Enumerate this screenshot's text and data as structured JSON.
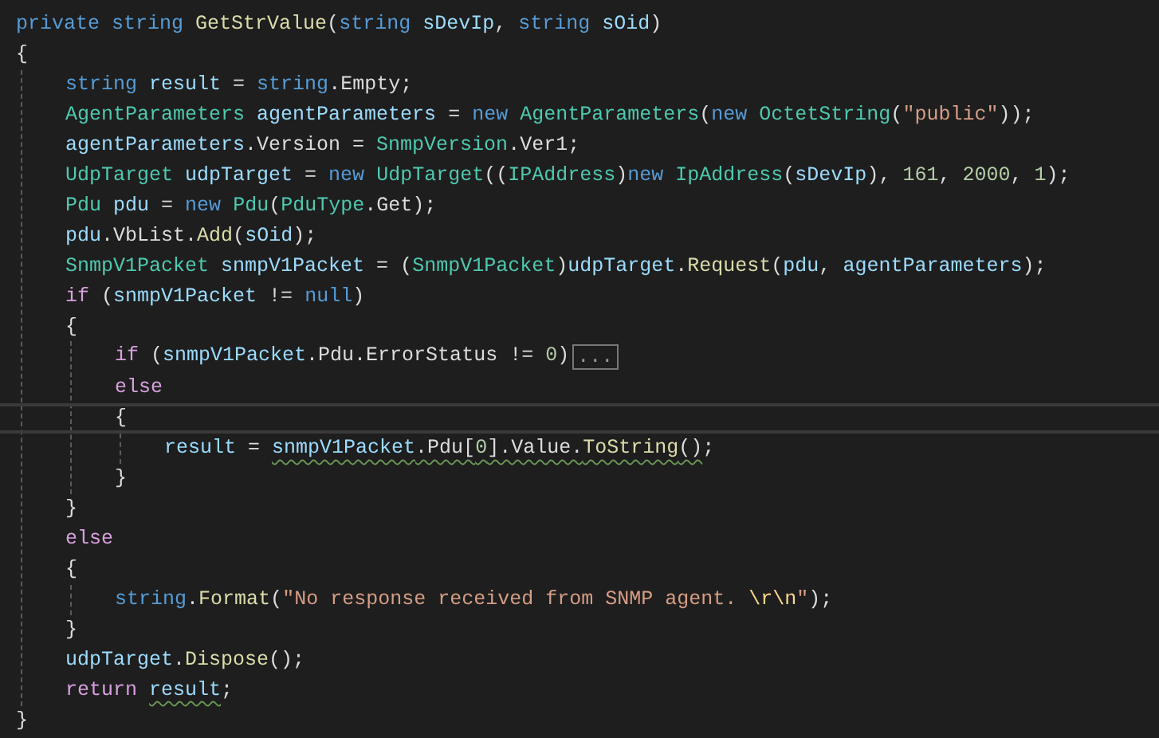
{
  "code_lines": [
    {
      "tokens": [
        {
          "text": "private ",
          "kind": "keyword"
        },
        {
          "text": "string ",
          "kind": "keyword"
        },
        {
          "text": "GetStrValue",
          "kind": "method"
        },
        {
          "text": "(",
          "kind": "plain"
        },
        {
          "text": "string ",
          "kind": "keyword"
        },
        {
          "text": "sDevIp",
          "kind": "variable"
        },
        {
          "text": ", ",
          "kind": "plain"
        },
        {
          "text": "string ",
          "kind": "keyword"
        },
        {
          "text": "sOid",
          "kind": "variable"
        },
        {
          "text": ")",
          "kind": "plain"
        }
      ]
    },
    {
      "tokens": [
        {
          "text": "{",
          "kind": "plain"
        }
      ],
      "children": [
        {
          "tokens": [
            {
              "text": "string ",
              "kind": "keyword"
            },
            {
              "text": "result",
              "kind": "variable"
            },
            {
              "text": " = ",
              "kind": "plain"
            },
            {
              "text": "string",
              "kind": "keyword"
            },
            {
              "text": ".Empty;",
              "kind": "plain"
            }
          ]
        },
        {
          "tokens": [
            {
              "text": "AgentParameters ",
              "kind": "type"
            },
            {
              "text": "agentParameters",
              "kind": "variable"
            },
            {
              "text": " = ",
              "kind": "plain"
            },
            {
              "text": "new ",
              "kind": "keyword"
            },
            {
              "text": "AgentParameters",
              "kind": "type"
            },
            {
              "text": "(",
              "kind": "plain"
            },
            {
              "text": "new ",
              "kind": "keyword"
            },
            {
              "text": "OctetString",
              "kind": "type"
            },
            {
              "text": "(",
              "kind": "plain"
            },
            {
              "text": "\"public\"",
              "kind": "string"
            },
            {
              "text": "));",
              "kind": "plain"
            }
          ]
        },
        {
          "tokens": [
            {
              "text": "agentParameters",
              "kind": "variable"
            },
            {
              "text": ".Version = ",
              "kind": "plain"
            },
            {
              "text": "SnmpVersion",
              "kind": "type"
            },
            {
              "text": ".Ver1;",
              "kind": "plain"
            }
          ]
        },
        {
          "tokens": [
            {
              "text": "UdpTarget ",
              "kind": "type"
            },
            {
              "text": "udpTarget",
              "kind": "variable"
            },
            {
              "text": " = ",
              "kind": "plain"
            },
            {
              "text": "new ",
              "kind": "keyword"
            },
            {
              "text": "UdpTarget",
              "kind": "type"
            },
            {
              "text": "((",
              "kind": "plain"
            },
            {
              "text": "IPAddress",
              "kind": "type"
            },
            {
              "text": ")",
              "kind": "plain"
            },
            {
              "text": "new ",
              "kind": "keyword"
            },
            {
              "text": "IpAddress",
              "kind": "type"
            },
            {
              "text": "(",
              "kind": "plain"
            },
            {
              "text": "sDevIp",
              "kind": "variable"
            },
            {
              "text": "), ",
              "kind": "plain"
            },
            {
              "text": "161",
              "kind": "number"
            },
            {
              "text": ", ",
              "kind": "plain"
            },
            {
              "text": "2000",
              "kind": "number"
            },
            {
              "text": ", ",
              "kind": "plain"
            },
            {
              "text": "1",
              "kind": "number"
            },
            {
              "text": ");",
              "kind": "plain"
            }
          ]
        },
        {
          "tokens": [
            {
              "text": "Pdu ",
              "kind": "type"
            },
            {
              "text": "pdu",
              "kind": "variable"
            },
            {
              "text": " = ",
              "kind": "plain"
            },
            {
              "text": "new ",
              "kind": "keyword"
            },
            {
              "text": "Pdu",
              "kind": "type"
            },
            {
              "text": "(",
              "kind": "plain"
            },
            {
              "text": "PduType",
              "kind": "type"
            },
            {
              "text": ".Get);",
              "kind": "plain"
            }
          ]
        },
        {
          "tokens": [
            {
              "text": "pdu",
              "kind": "variable"
            },
            {
              "text": ".VbList.",
              "kind": "plain"
            },
            {
              "text": "Add",
              "kind": "method"
            },
            {
              "text": "(",
              "kind": "plain"
            },
            {
              "text": "sOid",
              "kind": "variable"
            },
            {
              "text": ");",
              "kind": "plain"
            }
          ]
        },
        {
          "tokens": [
            {
              "text": "SnmpV1Packet ",
              "kind": "type"
            },
            {
              "text": "snmpV1Packet",
              "kind": "variable"
            },
            {
              "text": " = (",
              "kind": "plain"
            },
            {
              "text": "SnmpV1Packet",
              "kind": "type"
            },
            {
              "text": ")",
              "kind": "plain"
            },
            {
              "text": "udpTarget",
              "kind": "variable"
            },
            {
              "text": ".",
              "kind": "plain"
            },
            {
              "text": "Request",
              "kind": "method"
            },
            {
              "text": "(",
              "kind": "plain"
            },
            {
              "text": "pdu",
              "kind": "variable"
            },
            {
              "text": ", ",
              "kind": "plain"
            },
            {
              "text": "agentParameters",
              "kind": "variable"
            },
            {
              "text": ");",
              "kind": "plain"
            }
          ]
        },
        {
          "tokens": [
            {
              "text": "if",
              "kind": "control"
            },
            {
              "text": " (",
              "kind": "plain"
            },
            {
              "text": "snmpV1Packet",
              "kind": "variable"
            },
            {
              "text": " != ",
              "kind": "plain"
            },
            {
              "text": "null",
              "kind": "keyword"
            },
            {
              "text": ")",
              "kind": "plain"
            }
          ]
        },
        {
          "tokens": [
            {
              "text": "{",
              "kind": "plain"
            }
          ],
          "children": [
            {
              "tokens": [
                {
                  "text": "if",
                  "kind": "control"
                },
                {
                  "text": " (",
                  "kind": "plain"
                },
                {
                  "text": "snmpV1Packet",
                  "kind": "variable"
                },
                {
                  "text": ".Pdu.ErrorStatus != ",
                  "kind": "plain"
                },
                {
                  "text": "0",
                  "kind": "number"
                },
                {
                  "text": ")",
                  "kind": "plain"
                }
              ],
              "collapsed": "..."
            },
            {
              "tokens": [
                {
                  "text": "else",
                  "kind": "control"
                }
              ]
            },
            {
              "tokens": [
                {
                  "text": "{",
                  "kind": "plain"
                }
              ],
              "current": true,
              "children": [
                {
                  "tokens": [
                    {
                      "text": "result",
                      "kind": "variable"
                    },
                    {
                      "text": " = ",
                      "kind": "plain"
                    },
                    {
                      "text": "snmpV1Packet",
                      "kind": "variable",
                      "squiggle": true
                    },
                    {
                      "text": ".Pdu[",
                      "kind": "plain",
                      "squiggle": true
                    },
                    {
                      "text": "0",
                      "kind": "number",
                      "squiggle": true
                    },
                    {
                      "text": "].Value.",
                      "kind": "plain",
                      "squiggle": true
                    },
                    {
                      "text": "ToString",
                      "kind": "method",
                      "squiggle": true
                    },
                    {
                      "text": "()",
                      "kind": "plain",
                      "squiggle": true
                    },
                    {
                      "text": ";",
                      "kind": "plain"
                    }
                  ]
                }
              ]
            },
            {
              "tokens": [
                {
                  "text": "}",
                  "kind": "plain"
                }
              ]
            }
          ]
        },
        {
          "tokens": [
            {
              "text": "}",
              "kind": "plain"
            }
          ]
        },
        {
          "tokens": [
            {
              "text": "else",
              "kind": "control"
            }
          ]
        },
        {
          "tokens": [
            {
              "text": "{",
              "kind": "plain"
            }
          ],
          "children": [
            {
              "tokens": [
                {
                  "text": "string",
                  "kind": "keyword"
                },
                {
                  "text": ".",
                  "kind": "plain"
                },
                {
                  "text": "Format",
                  "kind": "method"
                },
                {
                  "text": "(",
                  "kind": "plain"
                },
                {
                  "text": "\"No response received from SNMP agent. ",
                  "kind": "string"
                },
                {
                  "text": "\\r\\n",
                  "kind": "escape"
                },
                {
                  "text": "\"",
                  "kind": "string"
                },
                {
                  "text": ");",
                  "kind": "plain"
                }
              ]
            }
          ]
        },
        {
          "tokens": [
            {
              "text": "}",
              "kind": "plain"
            }
          ]
        },
        {
          "tokens": [
            {
              "text": "udpTarget",
              "kind": "variable"
            },
            {
              "text": ".",
              "kind": "plain"
            },
            {
              "text": "Dispose",
              "kind": "method"
            },
            {
              "text": "();",
              "kind": "plain"
            }
          ]
        },
        {
          "tokens": [
            {
              "text": "return ",
              "kind": "control"
            },
            {
              "text": "result",
              "kind": "variable",
              "squiggle": true
            },
            {
              "text": ";",
              "kind": "plain"
            }
          ]
        }
      ]
    },
    {
      "tokens": [
        {
          "text": "}",
          "kind": "plain"
        }
      ]
    }
  ]
}
